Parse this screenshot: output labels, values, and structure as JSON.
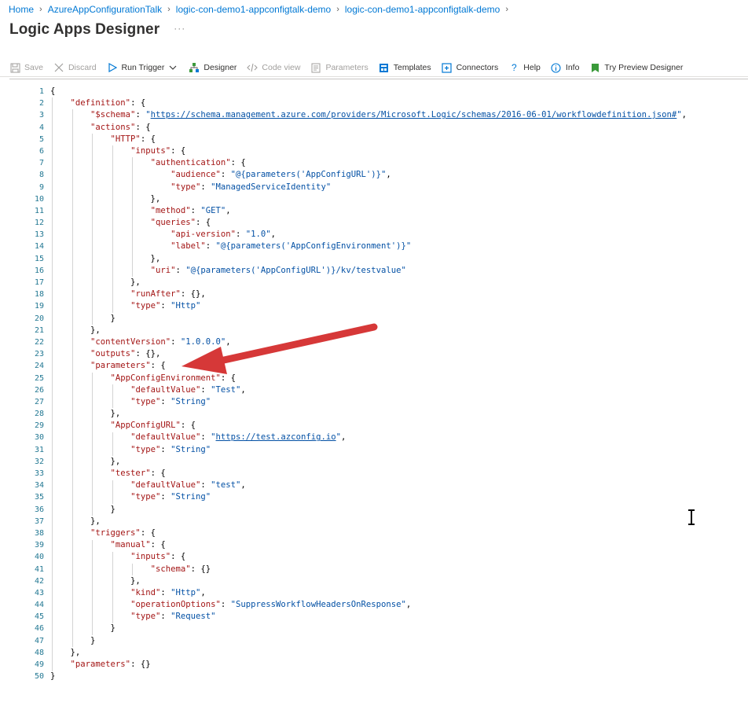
{
  "breadcrumb": [
    "Home",
    "AzureAppConfigurationTalk",
    "logic-con-demo1-appconfigtalk-demo",
    "logic-con-demo1-appconfigtalk-demo"
  ],
  "page_title": "Logic Apps Designer",
  "more_label": "···",
  "toolbar": {
    "save": "Save",
    "discard": "Discard",
    "run_trigger": "Run Trigger",
    "designer": "Designer",
    "code_view": "Code view",
    "parameters": "Parameters",
    "templates": "Templates",
    "connectors": "Connectors",
    "help": "Help",
    "info": "Info",
    "try_preview": "Try Preview Designer"
  },
  "colors": {
    "accent": "#0078d4",
    "arrow": "#e03c3c",
    "key": "#a31515",
    "string": "#0451a5",
    "line_number": "#237893"
  },
  "code": {
    "line_numbers": [
      "1",
      "2",
      "3",
      "4",
      "5",
      "6",
      "7",
      "8",
      "9",
      "10",
      "11",
      "12",
      "13",
      "14",
      "15",
      "16",
      "17",
      "18",
      "19",
      "20",
      "21",
      "22",
      "23",
      "24",
      "25",
      "26",
      "27",
      "28",
      "29",
      "30",
      "31",
      "32",
      "33",
      "34",
      "35",
      "36",
      "37",
      "38",
      "39",
      "40",
      "41",
      "42",
      "43",
      "44",
      "45",
      "46",
      "47",
      "48",
      "49",
      "50"
    ],
    "lines": [
      "{",
      "    \"definition\": {",
      "        \"$schema\": \"https://schema.management.azure.com/providers/Microsoft.Logic/schemas/2016-06-01/workflowdefinition.json#\",",
      "        \"actions\": {",
      "            \"HTTP\": {",
      "                \"inputs\": {",
      "                    \"authentication\": {",
      "                        \"audience\": \"@{parameters('AppConfigURL')}\",",
      "                        \"type\": \"ManagedServiceIdentity\"",
      "                    },",
      "                    \"method\": \"GET\",",
      "                    \"queries\": {",
      "                        \"api-version\": \"1.0\",",
      "                        \"label\": \"@{parameters('AppConfigEnvironment')}\"",
      "                    },",
      "                    \"uri\": \"@{parameters('AppConfigURL')}/kv/testvalue\"",
      "                },",
      "                \"runAfter\": {},",
      "                \"type\": \"Http\"",
      "            }",
      "        },",
      "        \"contentVersion\": \"1.0.0.0\",",
      "        \"outputs\": {},",
      "        \"parameters\": {",
      "            \"AppConfigEnvironment\": {",
      "                \"defaultValue\": \"Test\",",
      "                \"type\": \"String\"",
      "            },",
      "            \"AppConfigURL\": {",
      "                \"defaultValue\": \"https://test.azconfig.io\",",
      "                \"type\": \"String\"",
      "            },",
      "            \"tester\": {",
      "                \"defaultValue\": \"test\",",
      "                \"type\": \"String\"",
      "            }",
      "        },",
      "        \"triggers\": {",
      "            \"manual\": {",
      "                \"inputs\": {",
      "                    \"schema\": {}",
      "                },",
      "                \"kind\": \"Http\",",
      "                \"operationOptions\": \"SuppressWorkflowHeadersOnResponse\",",
      "                \"type\": \"Request\"",
      "            }",
      "        }",
      "    },",
      "    \"parameters\": {}",
      "}"
    ]
  }
}
